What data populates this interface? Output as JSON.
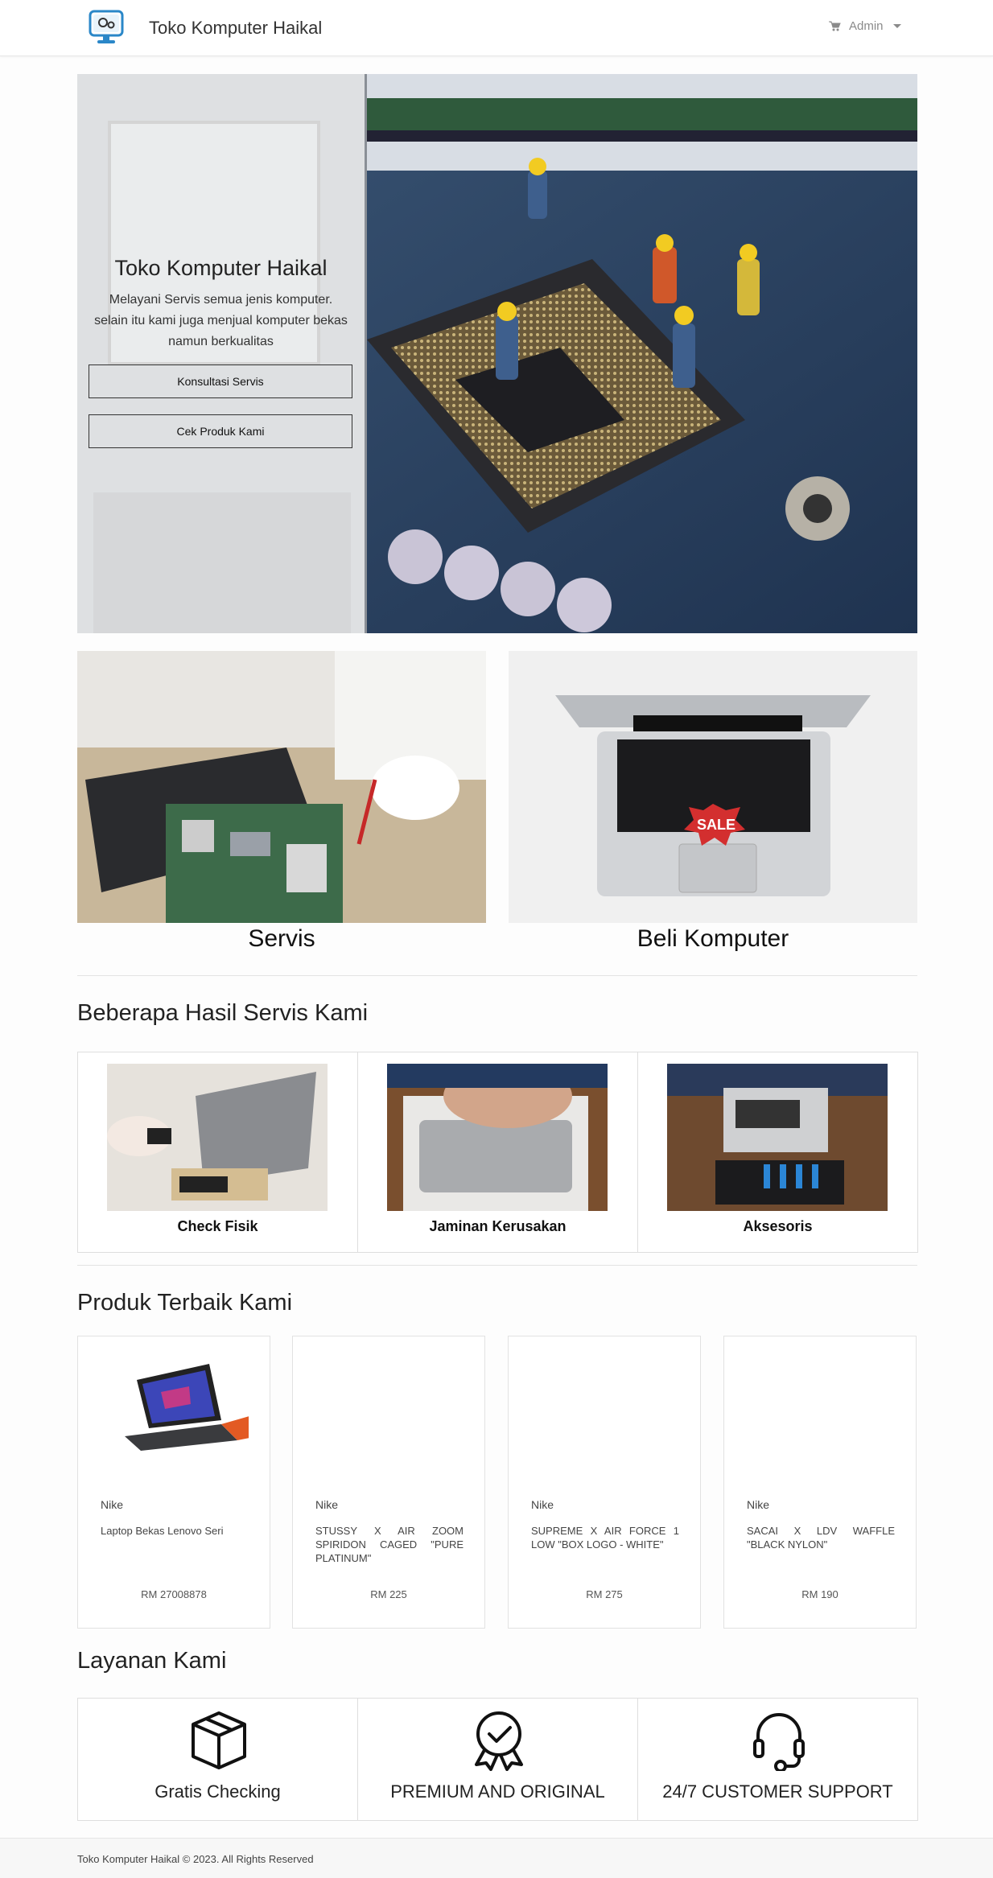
{
  "navbar": {
    "brand": "Toko Komputer Haikal",
    "user_label": "Admin",
    "icons": {
      "logo": "computer-gear-logo",
      "cart": "cart-icon",
      "caret": "caret-down-icon"
    }
  },
  "hero": {
    "title": "Toko Komputer Haikal",
    "description": "Melayani Servis semua jenis komputer. selain itu kami juga menjual komputer bekas namun berkualitas",
    "button_primary": "Konsultasi Servis",
    "button_secondary": "Cek Produk Kami"
  },
  "categories": [
    {
      "label": "Servis"
    },
    {
      "label": "Beli Komputer"
    }
  ],
  "service_results": {
    "title": "Beberapa Hasil Servis Kami",
    "items": [
      {
        "label": "Check Fisik"
      },
      {
        "label": "Jaminan Kerusakan"
      },
      {
        "label": "Aksesoris"
      }
    ]
  },
  "products": {
    "title": "Produk Terbaik Kami",
    "items": [
      {
        "brand": "Nike",
        "name": "Laptop Bekas Lenovo Seri",
        "price": "RM 27008878"
      },
      {
        "brand": "Nike",
        "name": "STUSSY X AIR ZOOM SPIRIDON CAGED \"PURE PLATINUM\"",
        "price": "RM 225"
      },
      {
        "brand": "Nike",
        "name": "SUPREME X AIR FORCE 1 LOW \"BOX LOGO - WHITE\"",
        "price": "RM 275"
      },
      {
        "brand": "Nike",
        "name": "SACAI X LDV WAFFLE \"BLACK NYLON\"",
        "price": "RM 190"
      }
    ]
  },
  "services": {
    "title": "Layanan Kami",
    "items": [
      {
        "label": "Gratis Checking",
        "icon": "box-icon"
      },
      {
        "label": "PREMIUM AND ORIGINAL",
        "icon": "badge-check-icon"
      },
      {
        "label": "24/7 CUSTOMER SUPPORT",
        "icon": "headset-icon"
      }
    ]
  },
  "footer": {
    "text": "Toko Komputer Haikal © 2023. All Rights Reserved"
  },
  "colors": {
    "background": "#fdfdfd",
    "navbar": "#ffffff",
    "board_blue": "#2b4466",
    "text": "#222222"
  }
}
